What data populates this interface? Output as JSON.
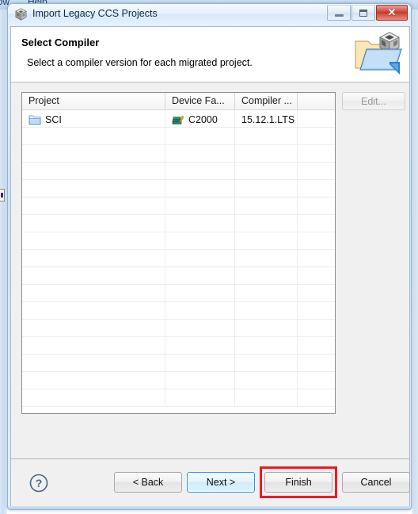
{
  "background": {
    "menu_window": "dow",
    "menu_help": "Help"
  },
  "window": {
    "title": "Import Legacy CCS Projects",
    "icon": "ccs-cube-icon",
    "controls": {
      "minimize": "minimize-icon",
      "maximize": "maximize-icon",
      "close": "✕"
    }
  },
  "banner": {
    "title": "Select Compiler",
    "description": "Select a compiler version for each migrated project.",
    "icon": "import-folder-cube-icon"
  },
  "table": {
    "columns": [
      {
        "label": "Project"
      },
      {
        "label": "Device Fa..."
      },
      {
        "label": "Compiler ..."
      },
      {
        "label": ""
      }
    ],
    "rows": [
      {
        "project_icon": "folder-icon",
        "project": "SCI",
        "device_icon": "library-books-icon",
        "device_family": "C2000",
        "compiler": "15.12.1.LTS",
        "extra": ""
      }
    ],
    "empty_row_count": 16
  },
  "side_controls": {
    "edit_label": "Edit...",
    "edit_enabled": false
  },
  "footer": {
    "help_icon": "help-question-icon",
    "buttons": [
      {
        "id": "back",
        "label": "< Back",
        "state": "normal"
      },
      {
        "id": "next",
        "label": "Next >",
        "state": "default-focused"
      },
      {
        "id": "finish",
        "label": "Finish",
        "state": "normal"
      },
      {
        "id": "cancel",
        "label": "Cancel",
        "state": "normal"
      }
    ],
    "highlight": {
      "target": "finish",
      "color": "#ec1c24"
    }
  }
}
